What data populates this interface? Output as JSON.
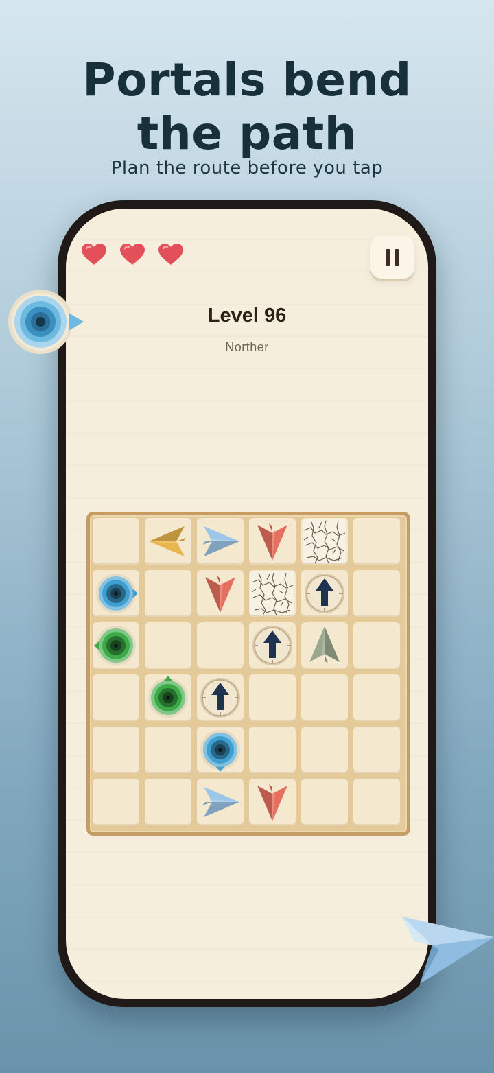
{
  "promo": {
    "headline_line1": "Portals bend",
    "headline_line2": "the path",
    "subhead": "Plan the route before you tap"
  },
  "hud": {
    "hearts": 3,
    "heart_color": "#e4505a"
  },
  "level": {
    "title": "Level 96",
    "subtitle": "Norther"
  },
  "board": {
    "rows": 6,
    "cols": 6,
    "cells": [
      [
        "",
        "plane-left-yellow",
        "plane-right-blue",
        "plane-down-red",
        "cracked",
        ""
      ],
      [
        "portal-blue-right",
        "",
        "plane-down-red",
        "cracked",
        "arrow-up",
        ""
      ],
      [
        "portal-green-left",
        "",
        "",
        "arrow-up",
        "plane-up-green",
        ""
      ],
      [
        "",
        "portal-green-up",
        "arrow-up",
        "",
        "",
        ""
      ],
      [
        "",
        "",
        "portal-blue-down",
        "",
        "",
        ""
      ],
      [
        "",
        "",
        "plane-right-blue",
        "plane-down-red",
        "",
        ""
      ]
    ]
  },
  "colors": {
    "plane_yellow": "#e9b54d",
    "plane_blue": "#9cc6e8",
    "plane_red": "#e5705f",
    "plane_green": "#9aa88f",
    "portal_blue": "#3f9fd1",
    "portal_green": "#3cab47",
    "arrow_navy": "#1f3350"
  }
}
